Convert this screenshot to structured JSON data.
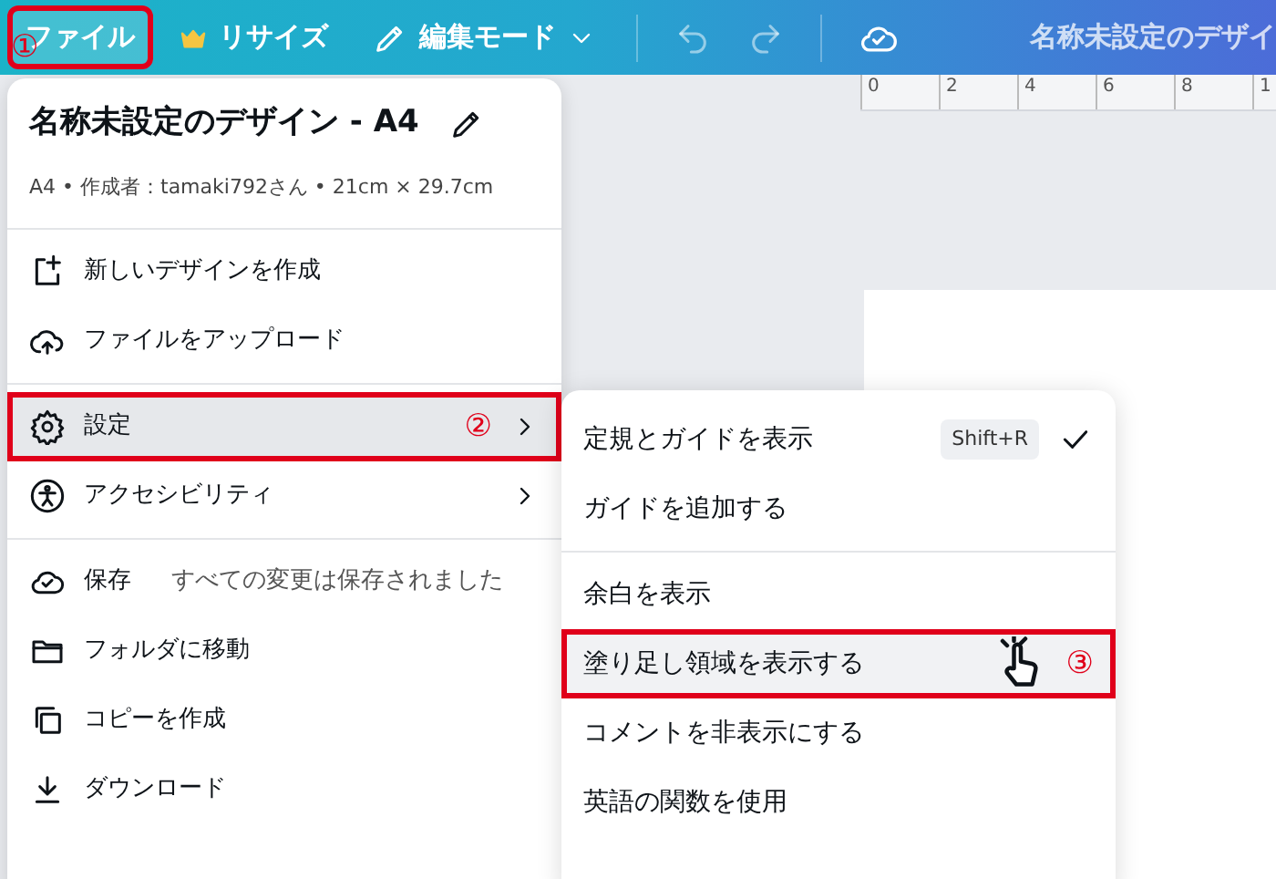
{
  "toolbar": {
    "buttons": [
      {
        "label": "ファイル",
        "selected": true,
        "callout": "①"
      },
      {
        "label": "リサイズ",
        "selected": false
      },
      {
        "label": "編集モード",
        "selected": false
      }
    ],
    "title": "名称未設定のデザイ"
  },
  "ruler": {
    "ticks": [
      "0",
      "2",
      "4",
      "6",
      "8",
      "1"
    ]
  },
  "file_menu": {
    "title": "名称未設定のデザイン - A4",
    "meta": "A4 • 作成者：tamaki792さん • 21cm × 29.7cm",
    "groups": [
      [
        {
          "label": "新しいデザインを作成",
          "selected": false,
          "submenu": false
        },
        {
          "label": "ファイルをアップロード",
          "selected": false,
          "submenu": false
        }
      ],
      [
        {
          "label": "設定",
          "selected": true,
          "submenu": true,
          "callout": "②"
        },
        {
          "label": "アクセシビリティ",
          "selected": false,
          "submenu": true
        }
      ],
      [
        {
          "label": "保存",
          "note": "すべての変更は保存されました",
          "selected": false,
          "submenu": false
        },
        {
          "label": "フォルダに移動",
          "selected": false,
          "submenu": false
        },
        {
          "label": "コピーを作成",
          "selected": false,
          "submenu": false
        },
        {
          "label": "ダウンロード",
          "selected": false,
          "submenu": false
        }
      ]
    ]
  },
  "settings_submenu": {
    "groups": [
      [
        {
          "label": "定規とガイドを表示",
          "shortcut": "Shift+R",
          "checked": true,
          "selected": false
        },
        {
          "label": "ガイドを追加する",
          "checked": false,
          "selected": false
        }
      ],
      [
        {
          "label": "余白を表示",
          "checked": false,
          "selected": false
        },
        {
          "label": "塗り足し領域を表示する",
          "checked": false,
          "selected": true,
          "callout": "③"
        },
        {
          "label": "コメントを非表示にする",
          "checked": false,
          "selected": false
        },
        {
          "label": "英語の関数を使用",
          "checked": false,
          "selected": false
        }
      ]
    ]
  }
}
